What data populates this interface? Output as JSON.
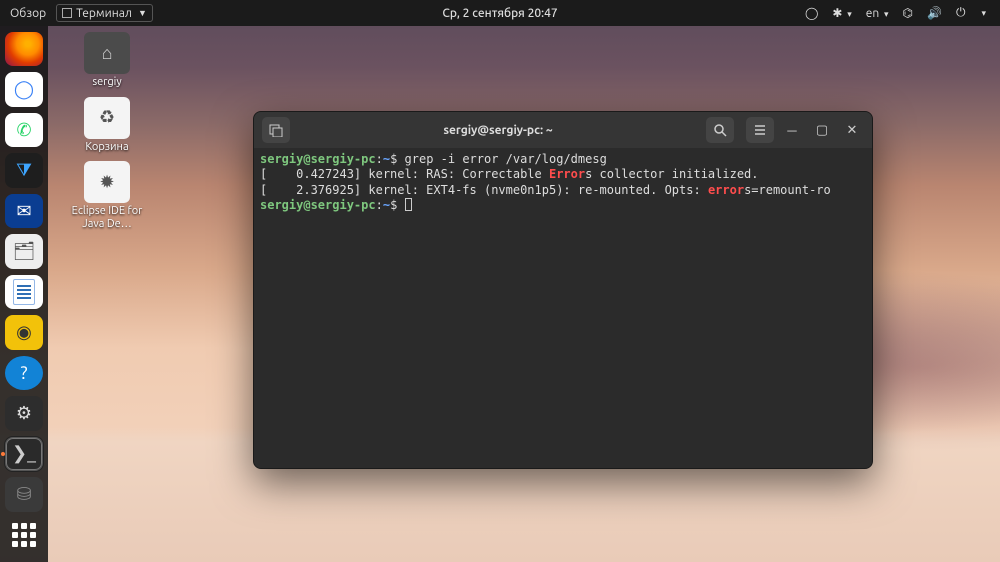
{
  "topbar": {
    "overview_label": "Обзор",
    "app_menu_label": "Терминал",
    "datetime": "Ср, 2 сентября  20:47",
    "lang_label": "en"
  },
  "dock": {
    "items": [
      {
        "name": "firefox",
        "glyph": "🔥"
      },
      {
        "name": "chromium",
        "glyph": "◯"
      },
      {
        "name": "whatsapp",
        "glyph": "✆"
      },
      {
        "name": "vscode",
        "glyph": "⧩"
      },
      {
        "name": "thunderbird",
        "glyph": "✉"
      },
      {
        "name": "files",
        "glyph": "📁"
      },
      {
        "name": "writer",
        "glyph": ""
      },
      {
        "name": "sound",
        "glyph": "◉"
      },
      {
        "name": "help",
        "glyph": "?"
      },
      {
        "name": "settings",
        "glyph": "⚙"
      },
      {
        "name": "term",
        "glyph": ">_"
      },
      {
        "name": "drive",
        "glyph": "⛁"
      }
    ]
  },
  "desktop": {
    "icons": [
      {
        "name": "home-folder",
        "label": "sergiy",
        "glyph": "⌂"
      },
      {
        "name": "trash",
        "label": "Корзина",
        "glyph": "♻"
      },
      {
        "name": "eclipse",
        "label": "Eclipse IDE for Java De…",
        "glyph": "✹"
      }
    ]
  },
  "terminal": {
    "title": "sergiy@sergiy-pc: ~",
    "prompt": {
      "user": "sergiy@sergiy-pc",
      "sep1": ":",
      "path": "~",
      "sigil": "$"
    },
    "command": "grep -i error /var/log/dmesg",
    "lines": [
      {
        "prefix": "[    0.427243] kernel: RAS: Correctable ",
        "hl": "Error",
        "suffix": "s collector initialized."
      },
      {
        "prefix": "[    2.376925] kernel: EXT4-fs (nvme0n1p5): re-mounted. Opts: ",
        "hl": "error",
        "suffix": "s=remount-ro"
      }
    ]
  }
}
